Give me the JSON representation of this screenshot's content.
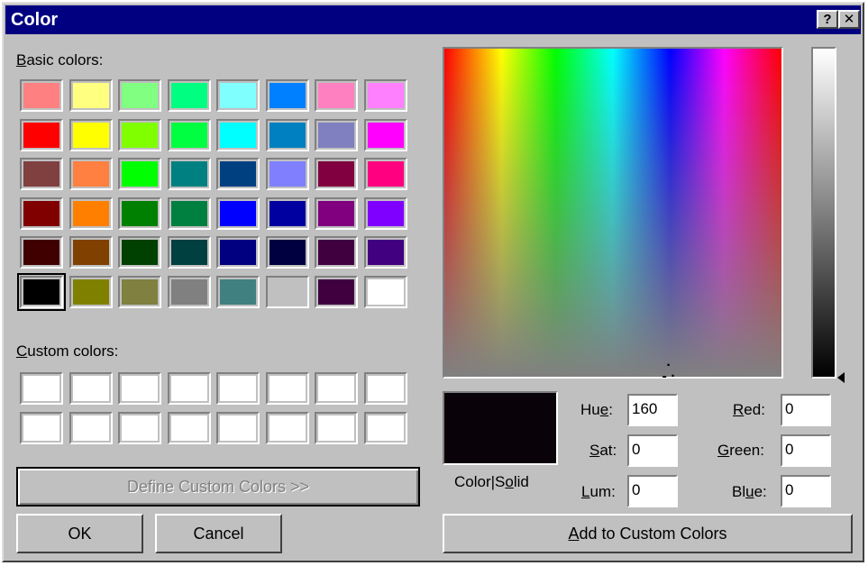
{
  "window": {
    "title": "Color",
    "help_label": "?",
    "close_label": "✕"
  },
  "basic_colors": {
    "label_prefix": "B",
    "label_rest": "asic colors:",
    "swatches": [
      "#ff8080",
      "#ffff80",
      "#80ff80",
      "#00ff80",
      "#80ffff",
      "#0080ff",
      "#ff80c0",
      "#ff80ff",
      "#ff0000",
      "#ffff00",
      "#80ff00",
      "#00ff40",
      "#00ffff",
      "#0080c0",
      "#8080c0",
      "#ff00ff",
      "#804040",
      "#ff8040",
      "#00ff00",
      "#008080",
      "#004080",
      "#8080ff",
      "#800040",
      "#ff0080",
      "#800000",
      "#ff8000",
      "#008000",
      "#008040",
      "#0000ff",
      "#0000a0",
      "#800080",
      "#8000ff",
      "#400000",
      "#804000",
      "#004000",
      "#004040",
      "#000080",
      "#000040",
      "#400040",
      "#400080",
      "#000000",
      "#808000",
      "#808040",
      "#808080",
      "#408080",
      "#c0c0c0",
      "#400040",
      "#ffffff"
    ],
    "selected_index": 40
  },
  "custom_colors": {
    "label_prefix": "C",
    "label_rest": "ustom colors:",
    "swatches": [
      "#ffffff",
      "#ffffff",
      "#ffffff",
      "#ffffff",
      "#ffffff",
      "#ffffff",
      "#ffffff",
      "#ffffff",
      "#ffffff",
      "#ffffff",
      "#ffffff",
      "#ffffff",
      "#ffffff",
      "#ffffff",
      "#ffffff",
      "#ffffff"
    ]
  },
  "buttons": {
    "define_custom": "Define Custom Colors >>",
    "ok": "OK",
    "cancel": "Cancel",
    "add_custom_prefix": "A",
    "add_custom_rest": "dd to Custom Colors"
  },
  "preview": {
    "label_a": "Color|S",
    "label_u": "o",
    "label_b": "lid",
    "color": "#0a0209"
  },
  "fields": {
    "hue": {
      "label_a": "Hu",
      "label_u": "e",
      "label_b": ":",
      "value": "160"
    },
    "sat": {
      "label_a": "",
      "label_u": "S",
      "label_b": "at:",
      "value": "0"
    },
    "lum": {
      "label_a": "",
      "label_u": "L",
      "label_b": "um:",
      "value": "0"
    },
    "red": {
      "label_a": "",
      "label_u": "R",
      "label_b": "ed:",
      "value": "0"
    },
    "green": {
      "label_a": "",
      "label_u": "G",
      "label_b": "reen:",
      "value": "0"
    },
    "blue": {
      "label_a": "Bl",
      "label_u": "u",
      "label_b": "e:",
      "value": "0"
    }
  },
  "colors": {
    "title_bar": "#000080",
    "dialog_face": "#c0c0c0"
  },
  "icons": {
    "crosshair": "crosshair-icon",
    "lum_arrow": "triangle-left-icon"
  }
}
